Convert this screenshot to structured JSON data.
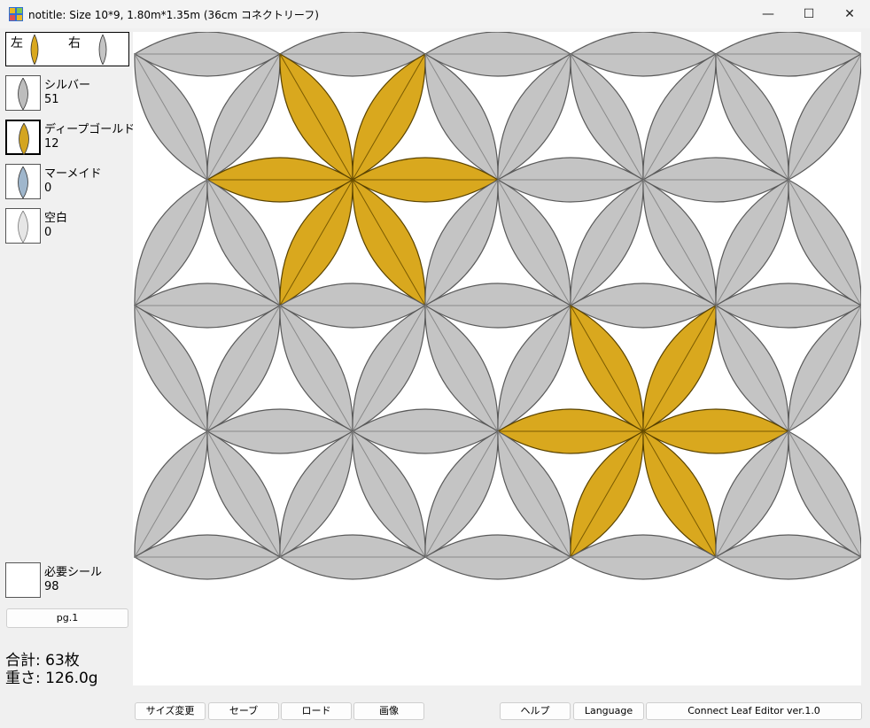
{
  "window": {
    "title": "notitle: Size 10*9, 1.80m*1.35m (36cm コネクトリーフ)",
    "minimize_glyph": "—",
    "maximize_glyph": "☐",
    "close_glyph": "✕"
  },
  "sidebar": {
    "left_label": "左",
    "right_label": "右",
    "palette": [
      {
        "name": "シルバー",
        "count": "51",
        "color": "#bdbdbd",
        "icon": "silver-leaf-icon"
      },
      {
        "name": "ディープゴールド",
        "count": "12",
        "color": "#d4a520",
        "icon": "gold-leaf-icon"
      },
      {
        "name": "マーメイド",
        "count": "0",
        "color": "#9fb6cc",
        "icon": "mermaid-leaf-icon"
      },
      {
        "name": "空白",
        "count": "0",
        "color": "#e6e6e6",
        "icon": "blank-leaf-icon"
      }
    ],
    "seal": {
      "name": "必要シール",
      "count": "98"
    },
    "page_button": "pg.1",
    "total": "合計: 63枚",
    "weight": "重さ: 126.0g"
  },
  "canvas": {
    "colors": {
      "silver": "#c4c4c4",
      "silver_stroke": "#5a5a5a",
      "gold": "#d9a81e",
      "gold_stroke": "#5a4300"
    },
    "gold_flower_centers": [
      [
        1,
        1
      ],
      [
        3,
        3
      ]
    ]
  },
  "toolbar": {
    "resize": "サイズ変更",
    "save": "セーブ",
    "load": "ロード",
    "image": "画像",
    "help": "ヘルプ",
    "language": "Language",
    "version": "Connect Leaf Editor ver.1.0"
  }
}
